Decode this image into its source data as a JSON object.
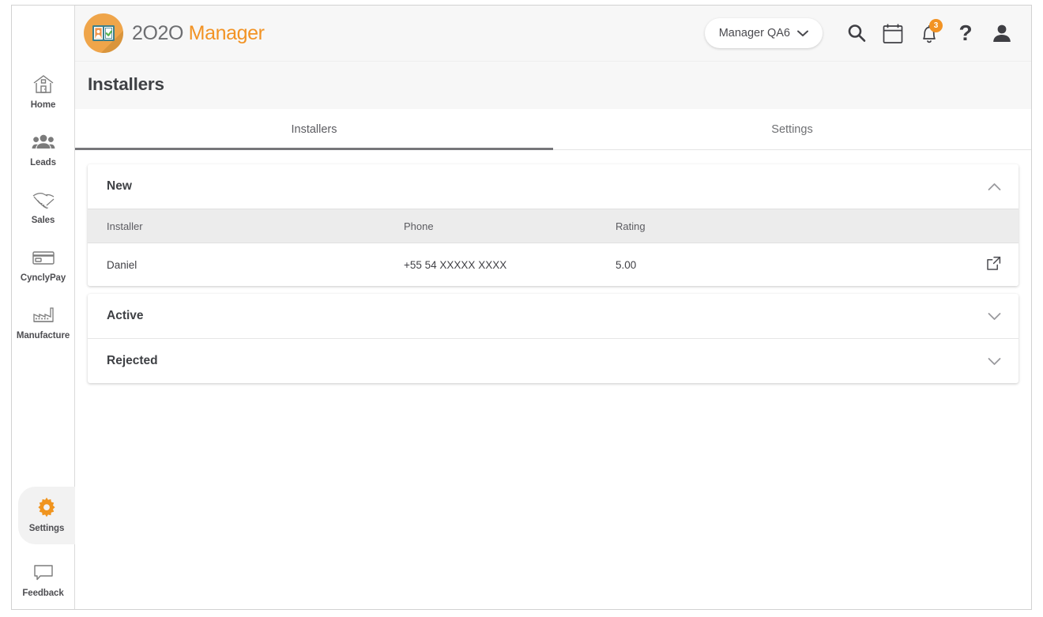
{
  "app": {
    "brand_primary": "2O2O",
    "brand_secondary": "Manager",
    "logo_color": "#efa54a",
    "accent_color": "#f29324"
  },
  "sidebar": {
    "items": [
      {
        "label": "Home",
        "icon": "home-icon",
        "active": false
      },
      {
        "label": "Leads",
        "icon": "people-icon",
        "active": false
      },
      {
        "label": "Sales",
        "icon": "handshake-icon",
        "active": false
      },
      {
        "label": "CynclyPay",
        "icon": "credit-card-icon",
        "active": false
      },
      {
        "label": "Manufacture",
        "icon": "factory-icon",
        "active": false
      },
      {
        "label": "Settings",
        "icon": "gear-icon",
        "active": true
      },
      {
        "label": "Feedback",
        "icon": "speech-bubble-icon",
        "active": false
      }
    ]
  },
  "topbar": {
    "user_chip_label": "Manager QA6",
    "search_icon": "search-icon",
    "calendar_icon": "calendar-icon",
    "notifications_icon": "bell-icon",
    "notifications_count": "3",
    "help_icon": "question-mark-icon",
    "help_label": "?",
    "account_icon": "user-avatar-icon"
  },
  "page": {
    "title": "Installers"
  },
  "tabs": [
    {
      "label": "Installers",
      "active": true
    },
    {
      "label": "Settings",
      "active": false
    }
  ],
  "sections": [
    {
      "title": "New",
      "expanded": true,
      "chevron": "chevron-up-icon",
      "columns": [
        "Installer",
        "Phone",
        "Rating"
      ],
      "rows": [
        {
          "installer": "Daniel",
          "phone": "+55 54  XXXXX XXXX",
          "rating": "5.00",
          "action_icon": "open-external-icon"
        }
      ]
    },
    {
      "title": "Active",
      "expanded": false,
      "chevron": "chevron-down-icon",
      "columns": [],
      "rows": []
    },
    {
      "title": "Rejected",
      "expanded": false,
      "chevron": "chevron-down-icon",
      "columns": [],
      "rows": []
    }
  ]
}
